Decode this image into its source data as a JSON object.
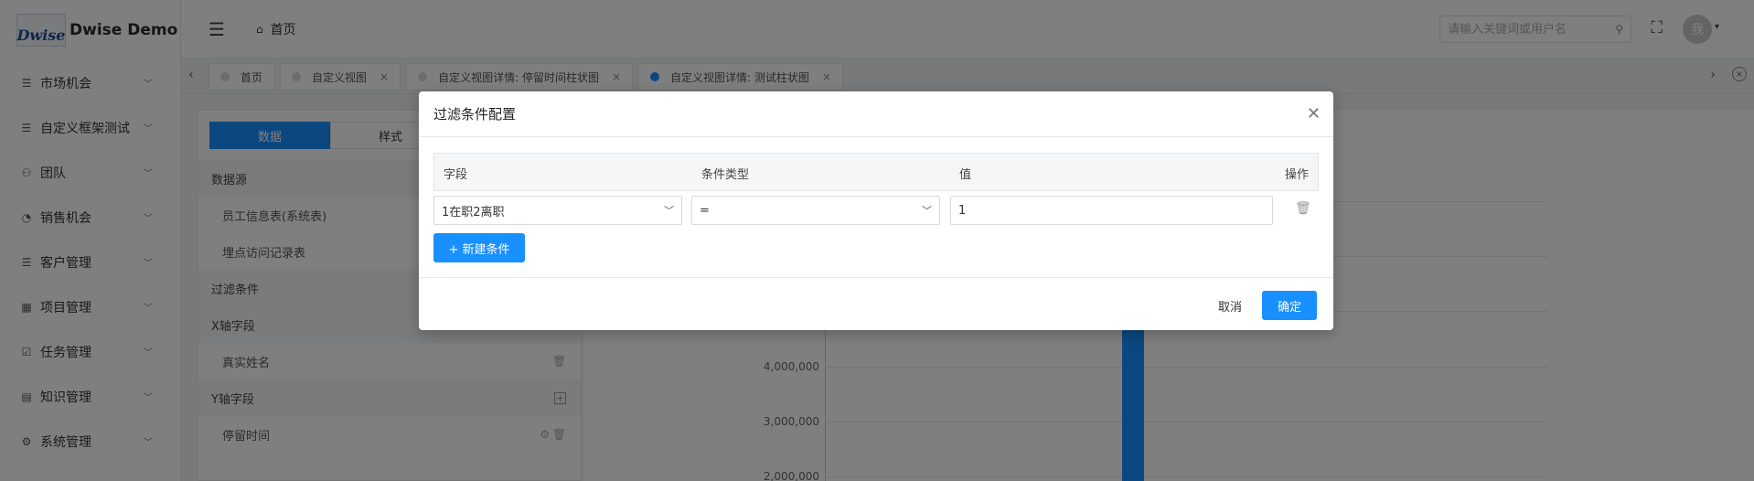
{
  "app": {
    "logo_mark": "Dwise",
    "title": "Dwise Demo"
  },
  "sidebar": {
    "items": [
      {
        "icon": "list-icon",
        "label": "市场机会"
      },
      {
        "icon": "list-icon",
        "label": "自定义框架测试"
      },
      {
        "icon": "team-icon",
        "label": "团队"
      },
      {
        "icon": "pie-icon",
        "label": "销售机会"
      },
      {
        "icon": "list-icon",
        "label": "客户管理"
      },
      {
        "icon": "grid-icon",
        "label": "项目管理"
      },
      {
        "icon": "checkbox-icon",
        "label": "任务管理"
      },
      {
        "icon": "book-icon",
        "label": "知识管理"
      },
      {
        "icon": "gear-icon",
        "label": "系统管理"
      }
    ]
  },
  "header": {
    "breadcrumb": "首页",
    "search_placeholder": "请输入关键词或用户名",
    "avatar_text": "我"
  },
  "tabs": [
    {
      "label": "首页",
      "closable": false,
      "active": false
    },
    {
      "label": "自定义视图",
      "closable": true,
      "active": false
    },
    {
      "label": "自定义视图详情: 停留时间柱状图",
      "closable": true,
      "active": false
    },
    {
      "label": "自定义视图详情: 测试柱状图",
      "closable": true,
      "active": true
    }
  ],
  "config_panel": {
    "segment": {
      "data": "数据",
      "style": "样式"
    },
    "datasource_label": "数据源",
    "datasources": [
      "员工信息表(系统表)",
      "埋点访问记录表"
    ],
    "filter_label": "过滤条件",
    "x_axis_label": "X轴字段",
    "x_fields": [
      "真实姓名"
    ],
    "y_axis_label": "Y轴字段",
    "y_fields": [
      "停留时间"
    ]
  },
  "chart_data": {
    "type": "bar",
    "ytick_labels": [
      "4,000,000",
      "3,000,000",
      "2,000,000"
    ],
    "grid": true
  },
  "modal": {
    "title": "过滤条件配置",
    "columns": {
      "field": "字段",
      "condition": "条件类型",
      "value": "值",
      "action": "操作"
    },
    "condition_row": {
      "field": "1在职2离职",
      "operator": "=",
      "value": "1"
    },
    "add_label": "+ 新建条件",
    "cancel_label": "取消",
    "ok_label": "确定"
  },
  "colors": {
    "primary": "#1890ff",
    "overlay": "rgba(0,0,0,0.5)"
  }
}
